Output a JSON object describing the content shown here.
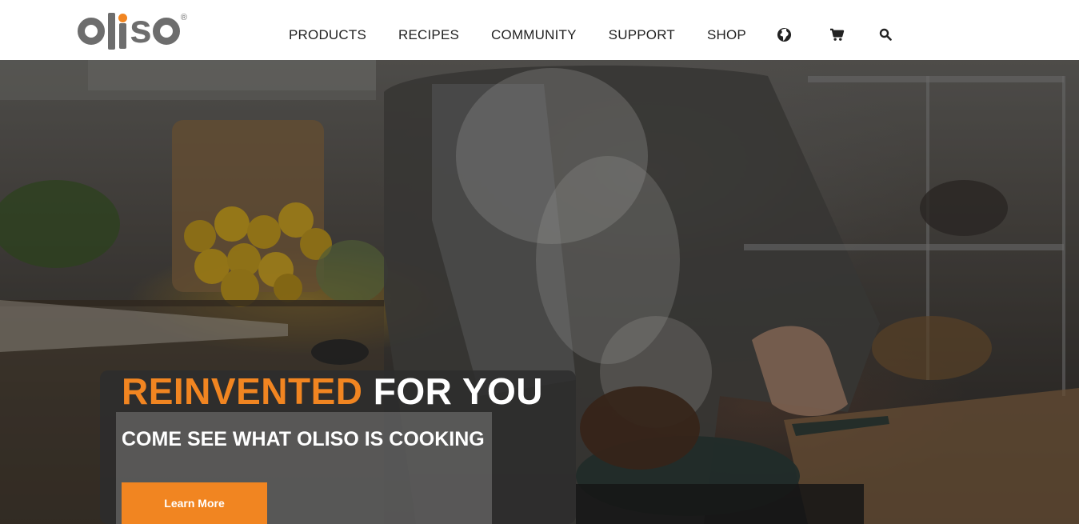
{
  "brand": {
    "logo_text_tail": "s",
    "registered_mark": "®",
    "accent_color": "#f18521",
    "logo_gray": "#6d6d6d"
  },
  "nav": {
    "items": [
      {
        "label": "PRODUCTS"
      },
      {
        "label": "RECIPES"
      },
      {
        "label": "COMMUNITY"
      },
      {
        "label": "SUPPORT"
      },
      {
        "label": "SHOP"
      }
    ],
    "icons": [
      "globe-icon",
      "cart-icon",
      "search-icon"
    ]
  },
  "hero": {
    "headline_accent": "REINVENTED",
    "headline_rest": " FOR YOU",
    "subheadline": "COME SEE WHAT OLISO IS COOKING",
    "cta_label": "Learn More"
  }
}
